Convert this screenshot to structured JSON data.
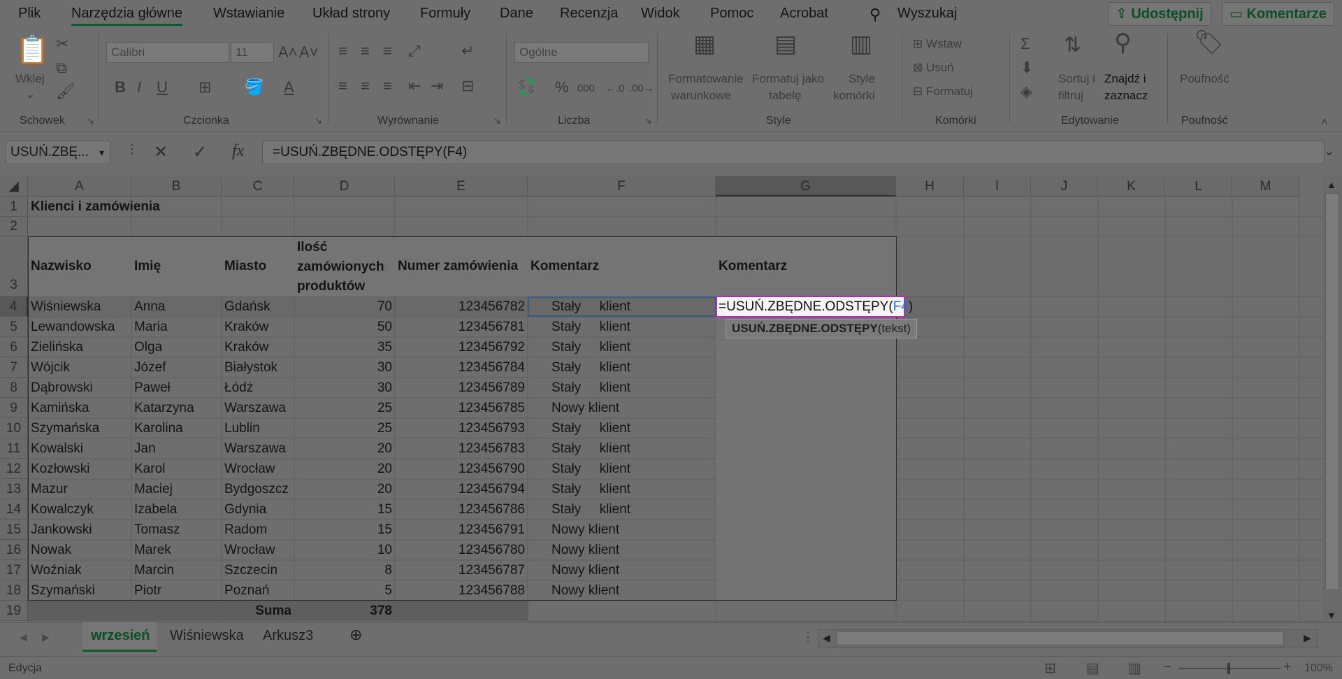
{
  "menu": {
    "items": [
      "Plik",
      "Narzędzia główne",
      "Wstawianie",
      "Układ strony",
      "Formuły",
      "Dane",
      "Recenzja",
      "Widok",
      "Pomoc",
      "Acrobat"
    ],
    "search": "Wyszukaj",
    "share": "Udostępnij",
    "comments": "Komentarze"
  },
  "ribbon": {
    "clipboard": {
      "paste": "Wklej",
      "group": "Schowek"
    },
    "font": {
      "name": "Calibri",
      "size": "11",
      "group": "Czcionka"
    },
    "alignment": {
      "group": "Wyrównanie"
    },
    "number": {
      "format": "Ogólne",
      "group": "Liczba"
    },
    "styles": {
      "conditional": [
        "Formatowanie",
        "warunkowe"
      ],
      "table": [
        "Formatuj jako",
        "tabelę"
      ],
      "cell": [
        "Style",
        "komórki"
      ],
      "group": "Style"
    },
    "cells": {
      "insert": "Wstaw",
      "delete": "Usuń",
      "format": "Formatuj",
      "group": "Komórki"
    },
    "editing": {
      "sort": [
        "Sortuj i",
        "filtruj"
      ],
      "find": [
        "Znajdź i",
        "zaznacz"
      ],
      "group": "Edytowanie"
    },
    "sensitivity": {
      "label": "Poufność",
      "group": "Poufność"
    }
  },
  "formula_bar": {
    "name_box": "USUŃ.ZBĘ...",
    "fx": "fx",
    "formula": "=USUŃ.ZBĘDNE.ODSTĘPY(F4)"
  },
  "columns": [
    "A",
    "B",
    "C",
    "D",
    "E",
    "F",
    "G",
    "H",
    "I",
    "J",
    "K",
    "L",
    "M"
  ],
  "rows": [
    "1",
    "2",
    "3",
    "4",
    "5",
    "6",
    "7",
    "8",
    "9",
    "10",
    "11",
    "12",
    "13",
    "14",
    "15",
    "16",
    "17",
    "18",
    "19"
  ],
  "sheet": {
    "title": "Klienci i zamówienia",
    "headers": {
      "surname": "Nazwisko",
      "name": "Imię",
      "city": "Miasto",
      "qty": [
        "Ilość",
        "zamówionych",
        "produktów"
      ],
      "order": "Numer zamówienia",
      "comment": "Komentarz",
      "comment2": "Komentarz"
    },
    "data": [
      [
        "Wiśniewska",
        "Anna",
        "Gdańsk",
        "70",
        "123456782",
        "Stały     klient"
      ],
      [
        "Lewandowska",
        "Maria",
        "Kraków",
        "50",
        "123456781",
        "Stały     klient"
      ],
      [
        "Zielińska",
        "Olga",
        "Kraków",
        "35",
        "123456792",
        "Stały     klient"
      ],
      [
        "Wójcik",
        "Józef",
        "Białystok",
        "30",
        "123456784",
        "Stały     klient"
      ],
      [
        "Dąbrowski",
        "Paweł",
        "Łódź",
        "30",
        "123456789",
        "Stały     klient"
      ],
      [
        "Kamińska",
        "Katarzyna",
        "Warszawa",
        "25",
        "123456785",
        "Nowy klient"
      ],
      [
        "Szymańska",
        "Karolina",
        "Lublin",
        "25",
        "123456793",
        "Stały     klient"
      ],
      [
        "Kowalski",
        "Jan",
        "Warszawa",
        "20",
        "123456783",
        "Stały     klient"
      ],
      [
        "Kozłowski",
        "Karol",
        "Wrocław",
        "20",
        "123456790",
        "Stały     klient"
      ],
      [
        "Mazur",
        "Maciej",
        "Bydgoszcz",
        "20",
        "123456794",
        "Stały     klient"
      ],
      [
        "Kowalczyk",
        "Izabela",
        "Gdynia",
        "15",
        "123456786",
        "Stały     klient"
      ],
      [
        "Jankowski",
        "Tomasz",
        "Radom",
        "15",
        "123456791",
        "Nowy klient"
      ],
      [
        "Nowak",
        "Marek",
        "Wrocław",
        "10",
        "123456780",
        "Nowy klient"
      ],
      [
        "Woźniak",
        "Marcin",
        "Szczecin",
        "8",
        "123456787",
        "Nowy klient"
      ],
      [
        "Szymański",
        "Piotr",
        "Poznań",
        "5",
        "123456788",
        "Nowy klient"
      ]
    ],
    "sum_label": "Suma",
    "sum_value": "378",
    "editing_cell_text": "=USUŃ.ZBĘDNE.ODSTĘPY(",
    "editing_cell_ref": "F4",
    "editing_cell_close": ")",
    "tooltip_fn": "USUŃ.ZBĘDNE.ODSTĘPY",
    "tooltip_args": "(tekst)"
  },
  "tabs": {
    "items": [
      "wrzesień",
      "Wiśniewska",
      "Arkusz3"
    ],
    "active": "wrzesień"
  },
  "status": {
    "mode": "Edycja",
    "zoom": "100%"
  },
  "colors": {
    "accent": "#0e5a2c",
    "ref": "#1f6fd0",
    "edit_border": "#b02cb4",
    "overlay": "#6e6e6e"
  }
}
